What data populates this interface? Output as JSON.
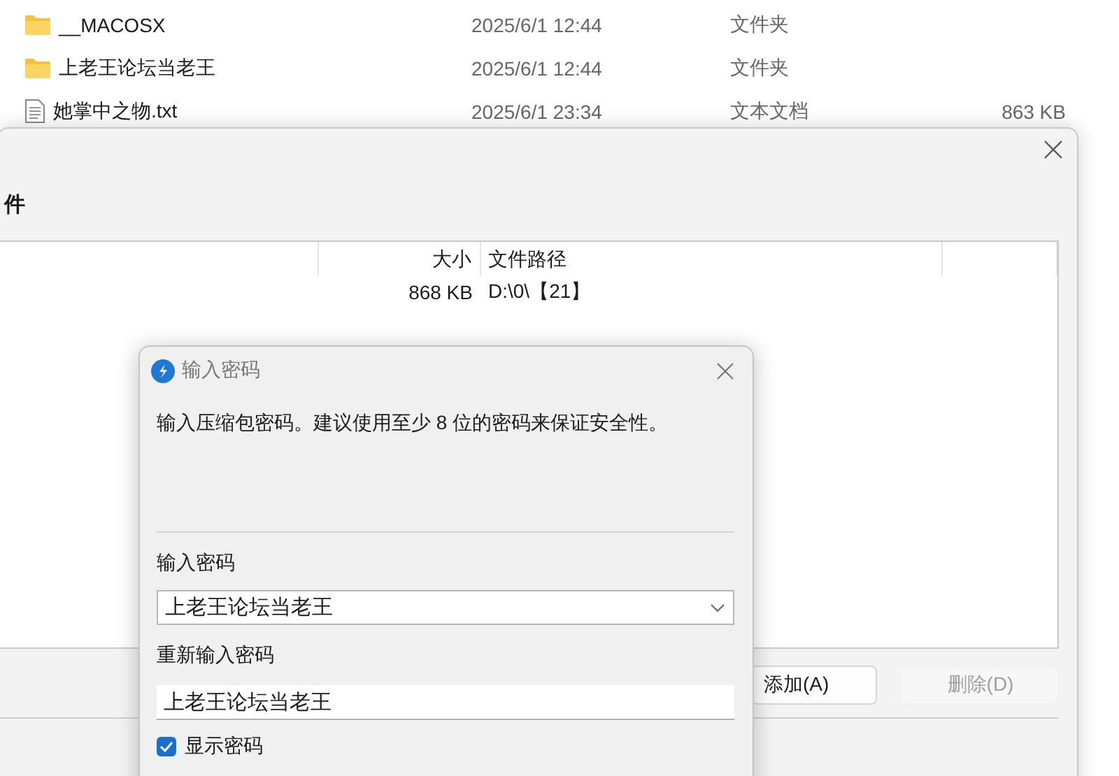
{
  "explorer_files": [
    {
      "kind": "folder",
      "name": "__MACOSX",
      "date": "2025/6/1 12:44",
      "type": "文件夹"
    },
    {
      "kind": "folder",
      "name": "上老王论坛当老王",
      "date": "2025/6/1 12:44",
      "type": "文件夹"
    },
    {
      "kind": "text",
      "name": "她掌中之物.txt",
      "date": "2025/6/1 23:34",
      "type": "文本文档",
      "size": "863 KB"
    }
  ],
  "files_dialog": {
    "title": "件",
    "columns": [
      "大小",
      "文件路径"
    ],
    "rows": [
      {
        "size": "868 KB",
        "path": "D:\\0\\【21】"
      }
    ],
    "buttons": [
      {
        "label": "添加(A)",
        "disabled": false
      },
      {
        "label": "删除(D)",
        "disabled": true
      }
    ]
  },
  "password_dialog": {
    "title": "输入密码",
    "message": "输入压缩包密码。建议使用至少 8 位的密码来保证安全性。",
    "password_label": "输入密码",
    "password_value": "上老王论坛当老王",
    "confirm_label": "重新输入密码",
    "confirm_value": "上老王论坛当老王",
    "show_password": {
      "label": "显示密码",
      "checked": true
    }
  }
}
